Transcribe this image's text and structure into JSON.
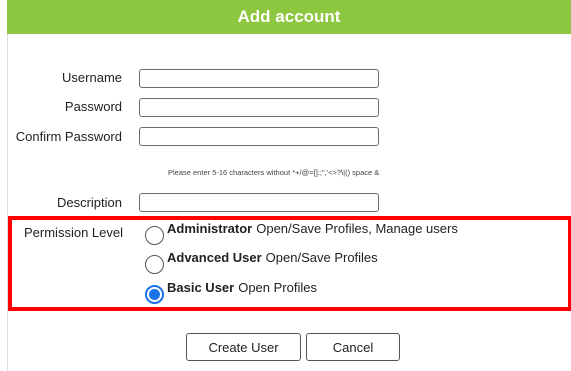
{
  "dialog": {
    "title": "Add account"
  },
  "form": {
    "username": {
      "label": "Username",
      "value": ""
    },
    "password": {
      "label": "Password",
      "value": ""
    },
    "confirm_password": {
      "label": "Confirm Password",
      "value": ""
    },
    "password_hint": "Please enter 5-16 characters without *+/@=[]:;\",'<>?\\|() space &",
    "description": {
      "label": "Description",
      "value": ""
    }
  },
  "permission": {
    "label": "Permission Level",
    "selected": "basic",
    "options": [
      {
        "id": "administrator",
        "name": "Administrator",
        "desc": "Open/Save Profiles, Manage users"
      },
      {
        "id": "advanced",
        "name": "Advanced User",
        "desc": "Open/Save Profiles"
      },
      {
        "id": "basic",
        "name": "Basic User",
        "desc": "Open Profiles"
      }
    ]
  },
  "buttons": {
    "create": "Create User",
    "cancel": "Cancel"
  },
  "colors": {
    "title_bar": "#8dc63f",
    "highlight": "#ff0000",
    "radio_selected": "#1a73e8"
  }
}
